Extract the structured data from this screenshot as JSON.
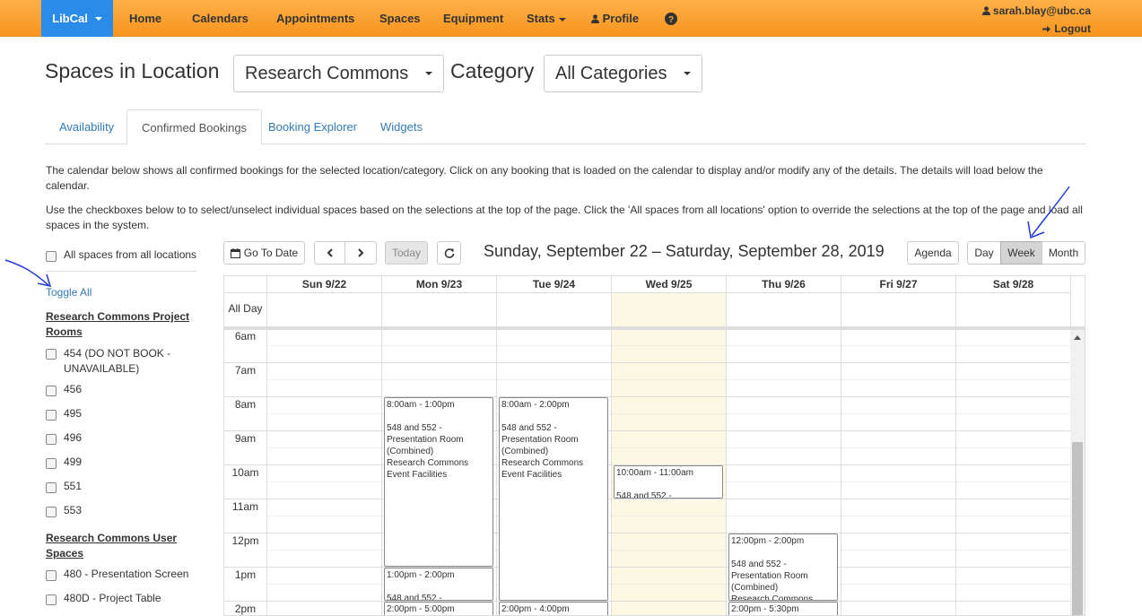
{
  "nav": {
    "brand": "LibCal",
    "items": [
      "Home",
      "Calendars",
      "Appointments",
      "Spaces",
      "Equipment",
      "Stats",
      "Profile"
    ],
    "user": "sarah.blay@ubc.ca",
    "logout": "Logout"
  },
  "header": {
    "title": "Spaces in Location",
    "location": "Research Commons",
    "category_label": "Category",
    "category": "All Categories"
  },
  "tabs": [
    "Availability",
    "Confirmed Bookings",
    "Booking Explorer",
    "Widgets"
  ],
  "info": {
    "p1": "The calendar below shows all confirmed bookings for the selected location/category. Click on any booking that is loaded on the calendar to display and/or modify any of the details. The details will load below the calendar.",
    "p2": "Use the checkboxes below to to select/unselect individual spaces based on the selections at the top of the page. Click the 'All spaces from all locations' option to override the selections at the top of the page and load all spaces in the system."
  },
  "sidebar": {
    "all_spaces": "All spaces from all locations",
    "toggle_all": "Toggle All",
    "group1": "Research Commons Project Rooms",
    "rooms": [
      "454 (DO NOT BOOK - UNAVAILABLE)",
      "456",
      "495",
      "496",
      "499",
      "551",
      "553"
    ],
    "group2": "Research Commons User Spaces",
    "user_spaces": [
      "480 - Presentation Screen",
      "480D - Project Table"
    ]
  },
  "toolbar": {
    "go_to_date": "Go To Date",
    "today": "Today",
    "title": "Sunday, September 22 – Saturday, September 28, 2019",
    "agenda": "Agenda",
    "day": "Day",
    "week": "Week",
    "month": "Month"
  },
  "calendar": {
    "days": [
      "Sun 9/22",
      "Mon 9/23",
      "Tue 9/24",
      "Wed 9/25",
      "Thu 9/26",
      "Fri 9/27",
      "Sat 9/28"
    ],
    "all_day": "All Day",
    "times": [
      "6am",
      "7am",
      "8am",
      "9am",
      "10am",
      "11am",
      "12pm",
      "1pm",
      "2pm"
    ],
    "events": {
      "mon1": "8:00am - 1:00pm\n\n548 and 552 - Presentation Room (Combined)\nResearch Commons Event Facilities",
      "mon2": "1:00pm - 2:00pm\n\n548 and 552 -",
      "mon3": "2:00pm - 5:00pm",
      "tue1": "8:00am - 2:00pm\n\n548 and 552 - Presentation Room (Combined)\nResearch Commons Event Facilities",
      "tue2": "2:00pm - 4:00pm",
      "wed1": "10:00am - 11:00am\n\n548 and 552 -",
      "thu1": "12:00pm - 2:00pm\n\n548 and 552 - Presentation Room (Combined)\nResearch Commons",
      "thu2": "2:00pm - 5:30pm"
    }
  }
}
